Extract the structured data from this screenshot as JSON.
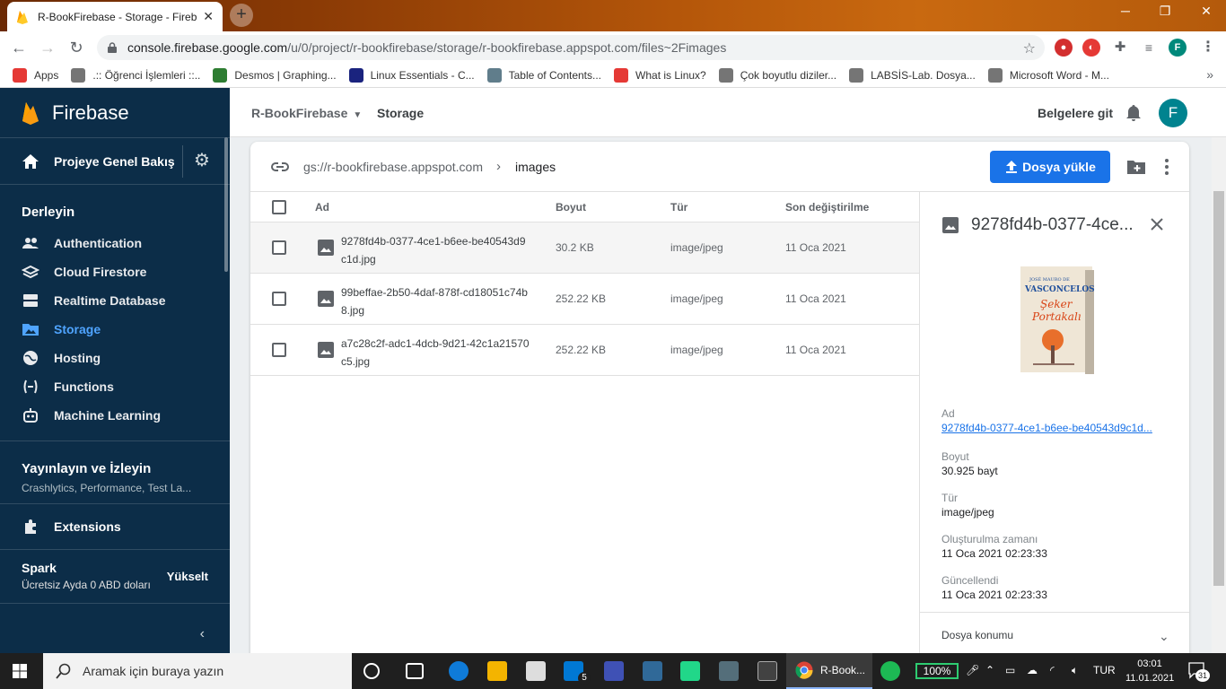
{
  "browser": {
    "tab_title": "R-BookFirebase - Storage - Fireb",
    "url_host": "console.firebase.google.com",
    "url_path": "/u/0/project/r-bookfirebase/storage/r-bookfirebase.appspot.com/files~2Fimages",
    "profile_initial": "F",
    "bookmarks": [
      {
        "label": "Apps",
        "color": "#e53935"
      },
      {
        "label": ".:: Öğrenci İşlemleri ::..",
        "color": "#757575"
      },
      {
        "label": "Desmos | Graphing...",
        "color": "#2e7d32"
      },
      {
        "label": "Linux Essentials - C...",
        "color": "#1a237e"
      },
      {
        "label": "Table of Contents...",
        "color": "#607d8b"
      },
      {
        "label": "What is Linux?",
        "color": "#e53935"
      },
      {
        "label": "Çok boyutlu diziler...",
        "color": "#757575"
      },
      {
        "label": "LABSİS-Lab. Dosya...",
        "color": "#757575"
      },
      {
        "label": "Microsoft Word - M...",
        "color": "#757575"
      }
    ]
  },
  "sidebar": {
    "brand": "Firebase",
    "overview": "Projeye Genel Bakış",
    "build_section": "Derleyin",
    "items": [
      {
        "label": "Authentication",
        "icon": "people-icon"
      },
      {
        "label": "Cloud Firestore",
        "icon": "firestore-icon"
      },
      {
        "label": "Realtime Database",
        "icon": "database-icon"
      },
      {
        "label": "Storage",
        "icon": "storage-icon"
      },
      {
        "label": "Hosting",
        "icon": "globe-icon"
      },
      {
        "label": "Functions",
        "icon": "functions-icon"
      },
      {
        "label": "Machine Learning",
        "icon": "robot-icon"
      }
    ],
    "release_title": "Yayınlayın ve İzleyin",
    "release_sub": "Crashlytics, Performance, Test La...",
    "extensions": "Extensions",
    "plan_name": "Spark",
    "plan_desc": "Ücretsiz Ayda 0 ABD doları",
    "upgrade": "Yükselt",
    "accent": "#4fa4ff"
  },
  "header": {
    "project": "R-BookFirebase",
    "section": "Storage",
    "docs": "Belgelere git",
    "avatar": "F"
  },
  "storage": {
    "bucket": "gs://r-bookfirebase.appspot.com",
    "folder": "images",
    "upload_label": "Dosya yükle",
    "columns": {
      "name": "Ad",
      "size": "Boyut",
      "type": "Tür",
      "modified": "Son değiştirilme"
    },
    "rows": [
      {
        "name": "9278fd4b-0377-4ce1-b6ee-be40543d9c1d.jpg",
        "size": "30.2 KB",
        "type": "image/jpeg",
        "modified": "11 Oca 2021"
      },
      {
        "name": "99beffae-2b50-4daf-878f-cd18051c74b8.jpg",
        "size": "252.22 KB",
        "type": "image/jpeg",
        "modified": "11 Oca 2021"
      },
      {
        "name": "a7c28c2f-adc1-4dcb-9d21-42c1a21570c5.jpg",
        "size": "252.22 KB",
        "type": "image/jpeg",
        "modified": "11 Oca 2021"
      }
    ]
  },
  "detail": {
    "title": "9278fd4b-0377-4ce...",
    "name_label": "Ad",
    "name_value": "9278fd4b-0377-4ce1-b6ee-be40543d9c1d...",
    "size_label": "Boyut",
    "size_value": "30.925 bayt",
    "type_label": "Tür",
    "type_value": "image/jpeg",
    "created_label": "Oluşturulma zamanı",
    "created_value": "11 Oca 2021 02:23:33",
    "updated_label": "Güncellendi",
    "updated_value": "11 Oca 2021 02:23:33",
    "location_label": "Dosya konumu",
    "book_author": "JOSÉ MAURO DE",
    "book_title_1": "VASCONCELOS",
    "book_title_2": "Şeker",
    "book_title_3": "Portakalı"
  },
  "taskbar": {
    "search_placeholder": "Aramak için buraya yazın",
    "active_app": "R-Book...",
    "mail_badge": "5",
    "battery": "100%",
    "lang": "TUR",
    "time": "03:01",
    "date": "11.01.2021",
    "notif_count": "31"
  }
}
